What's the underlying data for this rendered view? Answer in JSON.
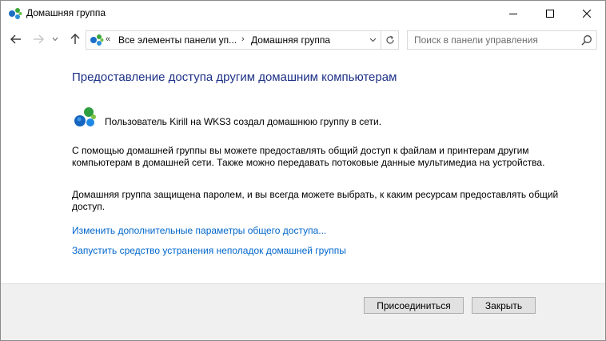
{
  "window": {
    "title": "Домашняя группа",
    "icon": "homegroup-icon",
    "controls": [
      "minimize-icon",
      "maximize-icon",
      "close-icon"
    ]
  },
  "navbar": {
    "breadcrumb_prefix": "«",
    "breadcrumb_parent": "Все элементы панели уп...",
    "breadcrumb_separator": "›",
    "breadcrumb_current": "Домашняя группа",
    "search_placeholder": "Поиск в панели управления",
    "search_value": ""
  },
  "content": {
    "heading": "Предоставление доступа другим домашним компьютерам",
    "creator_text": "Пользователь Kirill на WKS3 создал домашнюю группу в сети.",
    "paragraph1": "С помощью домашней группы вы можете предоставлять общий доступ к файлам и принтерам другим компьютерам в домашней сети. Также можно передавать потоковые данные мультимедиа на устройства.",
    "paragraph2": "Домашняя группа защищена паролем, и вы всегда можете выбрать, к каким ресурсам предоставлять общий доступ.",
    "link_sharing": "Изменить дополнительные параметры общего доступа...",
    "link_troubleshoot": "Запустить средство устранения неполадок домашней группы"
  },
  "footer": {
    "join_label": "Присоединиться",
    "close_label": "Закрыть"
  },
  "colors": {
    "heading": "#1e3287",
    "link": "#0066cc",
    "footer_bg": "#f0f0f0"
  }
}
